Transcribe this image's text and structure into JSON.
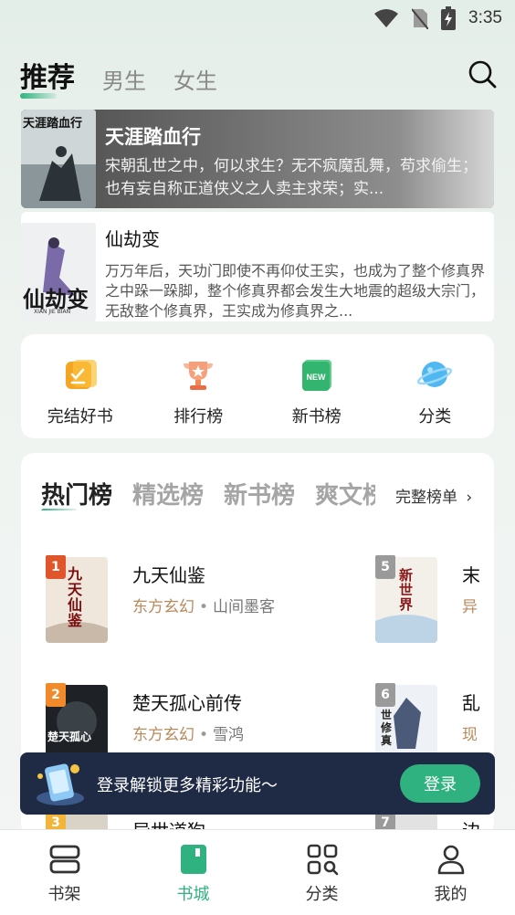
{
  "status_bar": {
    "time": "3:35",
    "icons": [
      "wifi-icon",
      "no-sim-icon",
      "battery-charging-icon"
    ]
  },
  "top_tabs": [
    {
      "label": "推荐",
      "active": true
    },
    {
      "label": "男生",
      "active": false
    },
    {
      "label": "女生",
      "active": false
    }
  ],
  "featured": [
    {
      "title": "天涯踏血行",
      "description": "宋朝乱世之中，何以求生？无不疯魔乱舞，苟求偷生；也有妄自称正道侠义之人卖主求荣；实...",
      "cover_text": "天涯踏血行"
    },
    {
      "title": "仙劫变",
      "description": "万万年后，天功门即使不再仰仗王实，也成为了整个修真界之中跺一跺脚，整个修真界都会发生大地震的超级大宗门，无敌整个修真界，王实成为修真界之...",
      "cover_text": "仙劫变",
      "cover_sub": "XIAN JIE BIAN"
    }
  ],
  "quick_entries": [
    {
      "label": "完结好书",
      "icon": "finished-books-icon"
    },
    {
      "label": "排行榜",
      "icon": "trophy-icon"
    },
    {
      "label": "新书榜",
      "icon": "new-badge-icon"
    },
    {
      "label": "分类",
      "icon": "planet-icon"
    }
  ],
  "rank_section": {
    "tabs": [
      {
        "label": "热门榜",
        "active": true
      },
      {
        "label": "精选榜",
        "active": false
      },
      {
        "label": "新书榜",
        "active": false
      },
      {
        "label": "爽文榜",
        "active": false
      }
    ],
    "full_list_label": "完整榜单",
    "items": [
      {
        "rank": "1",
        "title": "九天仙鉴",
        "genre": "东方玄幻",
        "author": "山间墨客",
        "cover_text": "九天仙鉴"
      },
      {
        "rank": "2",
        "title": "楚天孤心前传",
        "genre": "东方玄幻",
        "author": "雪鸿",
        "cover_text": "楚天孤心"
      },
      {
        "rank": "3",
        "title": "异世道狗",
        "genre": "",
        "author": "",
        "cover_text": ""
      },
      {
        "rank": "5",
        "title": "末",
        "genre": "异",
        "author": "",
        "cover_text": "新世界"
      },
      {
        "rank": "6",
        "title": "乱",
        "genre": "现",
        "author": "",
        "cover_text": "世修真"
      },
      {
        "rank": "7",
        "title": "边",
        "genre": "",
        "author": "",
        "cover_text": ""
      }
    ]
  },
  "login_banner": {
    "text": "登录解锁更多精彩功能～",
    "button_label": "登录"
  },
  "bottom_nav": [
    {
      "label": "书架",
      "icon": "bookshelf-icon",
      "active": false
    },
    {
      "label": "书城",
      "icon": "bookstore-icon",
      "active": true
    },
    {
      "label": "分类",
      "icon": "category-grid-icon",
      "active": false
    },
    {
      "label": "我的",
      "icon": "profile-icon",
      "active": false
    }
  ],
  "colors": {
    "accent": "#2fb27f",
    "banner_bg": "#1f2b45",
    "genre": "#b88a5c",
    "rank_1": "#e0552a",
    "rank_2": "#f08a2a",
    "rank_3": "#f2b53a",
    "rank_other": "#9a9a9a"
  }
}
